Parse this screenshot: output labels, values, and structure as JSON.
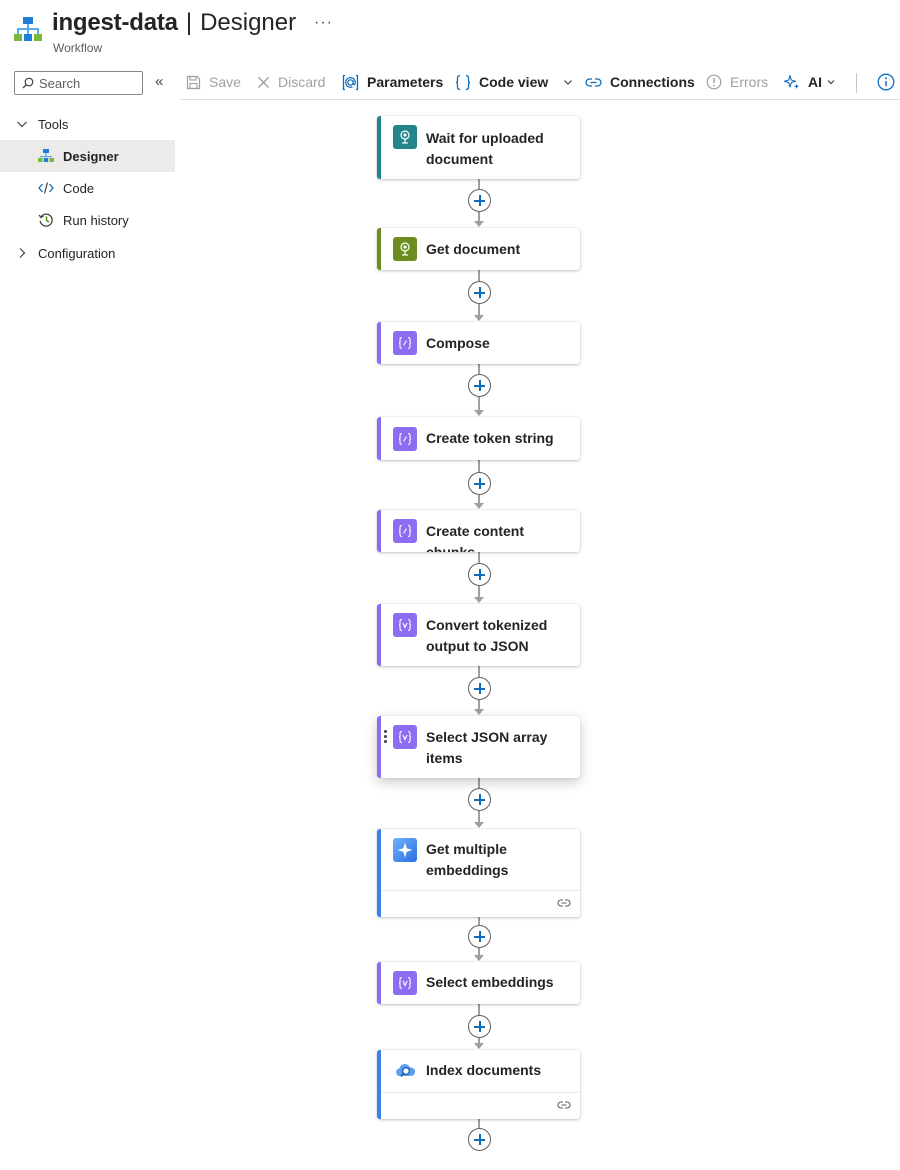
{
  "header": {
    "title": "ingest-data",
    "separator": "|",
    "subtitle": "Designer",
    "kind": "Workflow",
    "more_label": "···"
  },
  "search": {
    "placeholder": "Search"
  },
  "sidebar": {
    "collapse_label": "«",
    "groups": [
      {
        "label": "Tools",
        "expanded": true,
        "chevron": "chevron-down-icon"
      },
      {
        "label": "Configuration",
        "expanded": false,
        "chevron": "chevron-right-icon"
      }
    ],
    "items": [
      {
        "label": "Designer",
        "icon": "workflow-icon",
        "active": true
      },
      {
        "label": "Code",
        "icon": "code-icon",
        "active": false
      },
      {
        "label": "Run history",
        "icon": "history-icon",
        "active": false
      }
    ]
  },
  "toolbar": {
    "save": "Save",
    "discard": "Discard",
    "parameters": "Parameters",
    "code_view": "Code view",
    "connections": "Connections",
    "errors": "Errors",
    "ai": "AI"
  },
  "colors": {
    "trigger_teal": "#21858b",
    "sharepoint_green": "#6b8c1f",
    "data_ops_purple": "#8c6cf0",
    "openai_blue": "#3c82e6",
    "search_blue": "#3c82e6",
    "link_blue": "#0f6cbd"
  },
  "flow": {
    "steps": [
      {
        "label": "Wait for uploaded document",
        "icon": "document-trigger-icon",
        "color": "#21858b",
        "has_footer": false
      },
      {
        "label": "Get document",
        "icon": "document-action-icon",
        "color": "#6b8c1f",
        "has_footer": false
      },
      {
        "label": "Compose",
        "icon": "compose-icon",
        "color": "#8c6cf0",
        "has_footer": false
      },
      {
        "label": "Create token string",
        "icon": "compose-icon",
        "color": "#8c6cf0",
        "has_footer": false
      },
      {
        "label": "Create content chunks",
        "icon": "compose-icon",
        "color": "#8c6cf0",
        "has_footer": false
      },
      {
        "label": "Convert tokenized output to JSON",
        "icon": "data-operation-icon",
        "color": "#8c6cf0",
        "has_footer": false
      },
      {
        "label": "Select JSON array items",
        "icon": "data-operation-icon",
        "color": "#8c6cf0",
        "has_footer": false,
        "selected": true
      },
      {
        "label": "Get multiple embeddings",
        "icon": "openai-sparkle-icon",
        "color": "#3c82e6",
        "has_footer": true
      },
      {
        "label": "Select embeddings",
        "icon": "data-operation-icon",
        "color": "#8c6cf0",
        "has_footer": false
      },
      {
        "label": "Index documents",
        "icon": "ai-search-icon",
        "color": "#3c82e6",
        "has_footer": true
      }
    ]
  }
}
